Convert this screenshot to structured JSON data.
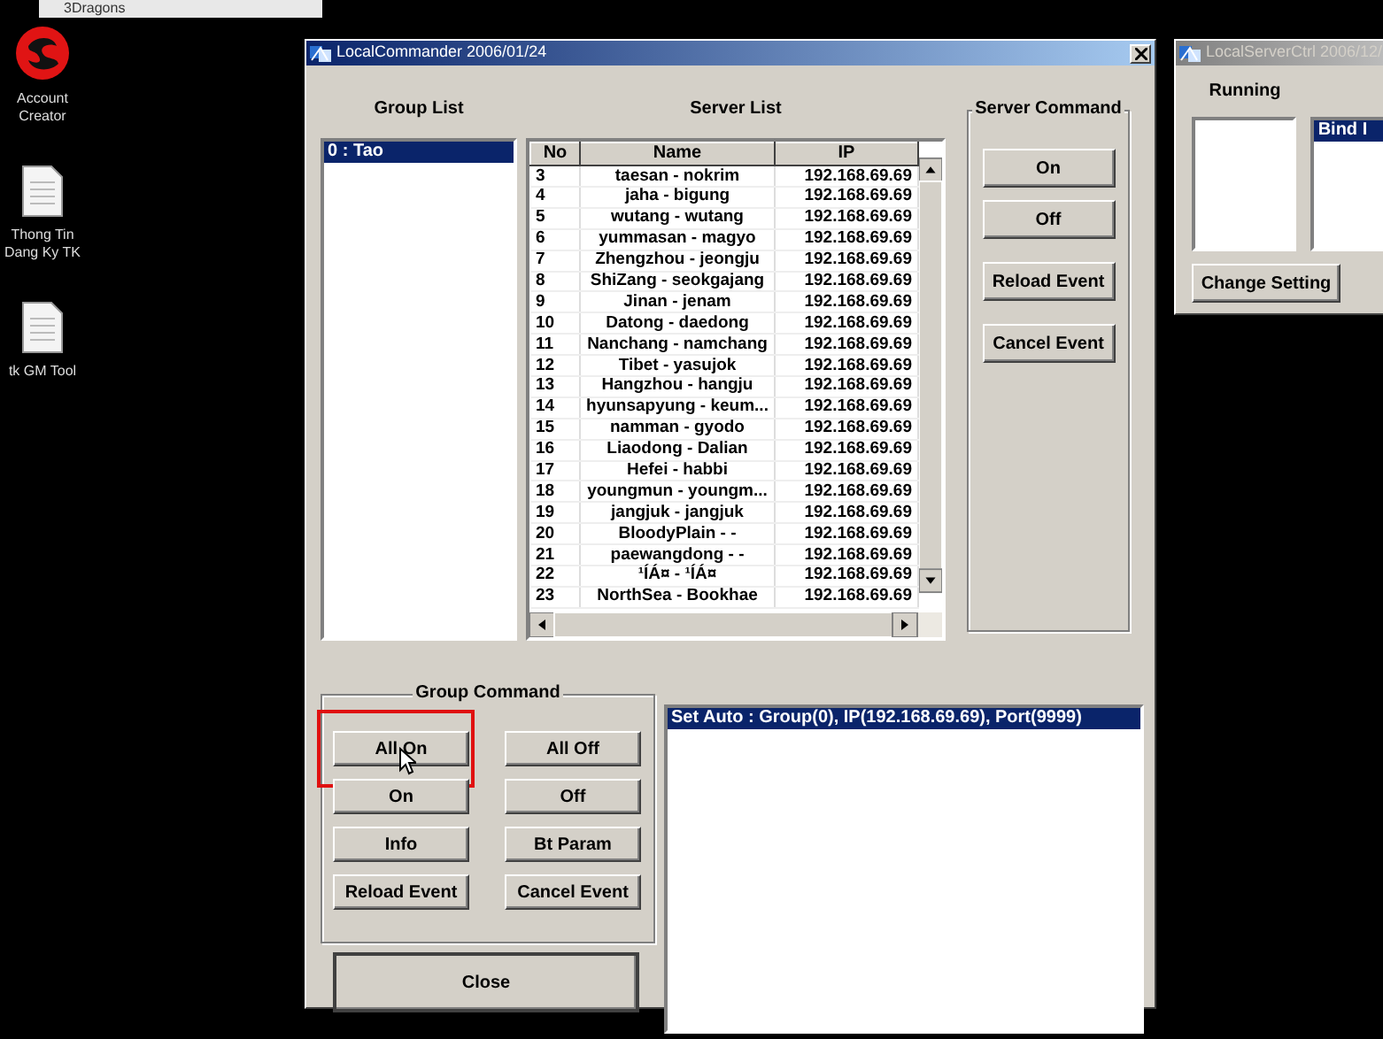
{
  "taskbar": {
    "title": "3Dragons"
  },
  "desktop_icons": [
    {
      "label": "Account Creator",
      "kind": "app"
    },
    {
      "label": "Thong Tin Dang Ky TK",
      "kind": "document"
    },
    {
      "label": "tk GM Tool",
      "kind": "document"
    }
  ],
  "main_window": {
    "title": "LocalCommander 2006/01/24",
    "group_list": {
      "heading": "Group List",
      "items": [
        {
          "label": "0 : Tao",
          "selected": true
        }
      ]
    },
    "server_list": {
      "heading": "Server List",
      "columns": [
        "No",
        "Name",
        "IP"
      ],
      "rows": [
        [
          "3",
          "taesan - nokrim",
          "192.168.69.69"
        ],
        [
          "4",
          "jaha - bigung",
          "192.168.69.69"
        ],
        [
          "5",
          "wutang - wutang",
          "192.168.69.69"
        ],
        [
          "6",
          "yummasan - magyo",
          "192.168.69.69"
        ],
        [
          "7",
          "Zhengzhou - jeongju",
          "192.168.69.69"
        ],
        [
          "8",
          "ShiZang - seokgajang",
          "192.168.69.69"
        ],
        [
          "9",
          "Jinan - jenam",
          "192.168.69.69"
        ],
        [
          "10",
          "Datong - daedong",
          "192.168.69.69"
        ],
        [
          "11",
          "Nanchang - namchang",
          "192.168.69.69"
        ],
        [
          "12",
          "Tibet - yasujok",
          "192.168.69.69"
        ],
        [
          "13",
          "Hangzhou - hangju",
          "192.168.69.69"
        ],
        [
          "14",
          "hyunsapyung - keum...",
          "192.168.69.69"
        ],
        [
          "15",
          "namman - gyodo",
          "192.168.69.69"
        ],
        [
          "16",
          "Liaodong - Dalian",
          "192.168.69.69"
        ],
        [
          "17",
          "Hefei - habbi",
          "192.168.69.69"
        ],
        [
          "18",
          "youngmun - youngm...",
          "192.168.69.69"
        ],
        [
          "19",
          "jangjuk - jangjuk",
          "192.168.69.69"
        ],
        [
          "20",
          "BloodyPlain - -",
          "192.168.69.69"
        ],
        [
          "21",
          "paewangdong - -",
          "192.168.69.69"
        ],
        [
          "22",
          "¹ÍÁ¤ - ¹ÍÁ¤",
          "192.168.69.69"
        ],
        [
          "23",
          "NorthSea - Bookhae",
          "192.168.69.69"
        ]
      ]
    },
    "server_command": {
      "heading": "Server Command",
      "buttons": [
        "On",
        "Off",
        "Reload Event",
        "Cancel Event"
      ]
    },
    "group_command": {
      "heading": "Group Command",
      "buttons": [
        {
          "label": "All On",
          "highlighted": true
        },
        {
          "label": "All Off",
          "highlighted": false
        },
        {
          "label": "On",
          "highlighted": false
        },
        {
          "label": "Off",
          "highlighted": false
        },
        {
          "label": "Info",
          "highlighted": false
        },
        {
          "label": "Bt Param",
          "highlighted": false
        },
        {
          "label": "Reload Event",
          "highlighted": false
        },
        {
          "label": "Cancel Event",
          "highlighted": false
        }
      ]
    },
    "close_button": "Close",
    "log": {
      "items": [
        {
          "text": "Set Auto : Group(0), IP(192.168.69.69), Port(9999)",
          "selected": true
        }
      ]
    }
  },
  "second_window": {
    "title": "LocalServerCtrl 2006/12/",
    "running_label": "Running",
    "bind_list": {
      "items": [
        {
          "text": "Bind I",
          "selected": true
        }
      ]
    },
    "button": "Change Setting"
  }
}
